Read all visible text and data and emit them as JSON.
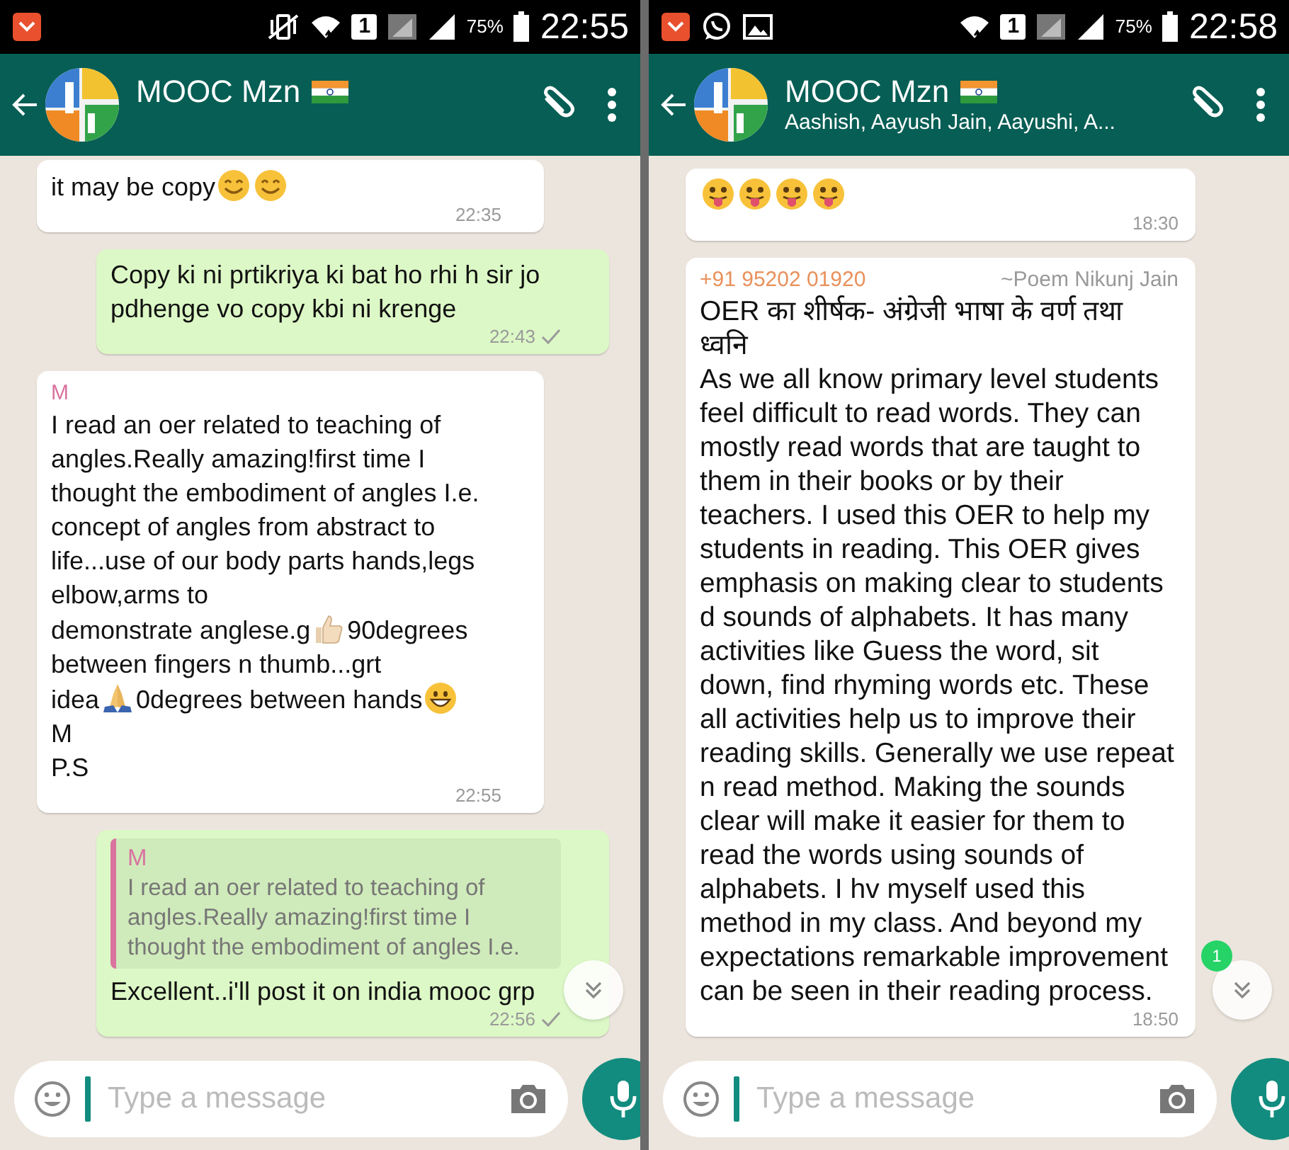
{
  "screens": [
    {
      "status_bar": {
        "notifications": [
          {
            "kind": "shop"
          }
        ],
        "vibrate_off": true,
        "sim": "1",
        "battery": "75%",
        "time": "22:55"
      },
      "header": {
        "title": "MOOC Mzn"
      },
      "messages": [
        {
          "outgoing": false,
          "paragraphs": [
            [
              {
                "kind": "text",
                "text": "it may be copy"
              },
              {
                "kind": "smiley"
              },
              {
                "kind": "smiley"
              }
            ]
          ],
          "time": "22:35"
        },
        {
          "outgoing": true,
          "paragraphs": [
            [
              {
                "kind": "text",
                "text": "Copy ki ni prtikriya ki bat ho rhi h sir jo pdhenge vo copy kbi ni krenge"
              }
            ]
          ],
          "time": "22:43",
          "sent": true
        },
        {
          "outgoing": false,
          "sender": {
            "name": "M",
            "color": "#d9739f"
          },
          "paragraphs": [
            [
              {
                "kind": "text",
                "text": "I read an oer related to teaching of angles.Really amazing!first time I thought the embodiment of angles I.e. concept of angles from abstract to life...use of our body parts hands,legs elbow,arms to"
              }
            ],
            [
              {
                "kind": "text",
                "text": "demonstrate anglese.g"
              },
              {
                "kind": "thumbsup"
              },
              {
                "kind": "text",
                "text": "90degrees"
              }
            ],
            [
              {
                "kind": "text",
                "text": "between fingers n thumb...grt"
              }
            ],
            [
              {
                "kind": "text",
                "text": "idea"
              },
              {
                "kind": "prayer"
              },
              {
                "kind": "text",
                "text": "0degrees between hands"
              },
              {
                "kind": "grin"
              }
            ],
            [
              {
                "kind": "text",
                "text": "M"
              }
            ],
            [
              {
                "kind": "text",
                "text": "P.S"
              }
            ]
          ],
          "time": "22:55"
        },
        {
          "outgoing": true,
          "quote": {
            "sender": "M",
            "color": "#d9739f",
            "text": "I read an oer related to teaching of angles.Really amazing!first time I thought the embodiment of angles I.e."
          },
          "paragraphs": [
            [
              {
                "kind": "text",
                "text": "Excellent..i'll post it on india mooc grp"
              }
            ]
          ],
          "time": "22:56",
          "sent": true
        }
      ],
      "scroll_button": {
        "shown": true
      },
      "composer": {
        "placeholder": "Type a message"
      }
    },
    {
      "status_bar": {
        "notifications": [
          {
            "kind": "shop"
          },
          {
            "kind": "chat"
          },
          {
            "kind": "gallery"
          }
        ],
        "vibrate_off": false,
        "sim": "1",
        "battery": "75%",
        "time": "22:58"
      },
      "header": {
        "title": "MOOC Mzn",
        "subtitle": "Aashish, Aayush Jain, Aayushi, A..."
      },
      "messages": [
        {
          "outgoing": false,
          "paragraphs": [
            [
              {
                "kind": "tongue"
              },
              {
                "kind": "tongue"
              },
              {
                "kind": "tongue"
              },
              {
                "kind": "tongue"
              }
            ]
          ],
          "time": "18:30"
        },
        {
          "outgoing": false,
          "sender": {
            "name": "+91 95202 01920",
            "color": "#e8915b"
          },
          "sender_note": "~Poem Nikunj Jain",
          "paragraphs": [
            [
              {
                "kind": "text",
                "text": "OER का शीर्षक- अंग्रेजी भाषा के वर्ण तथा ध्वनि"
              }
            ],
            [
              {
                "kind": "text",
                "text": "As we all know primary level students feel difficult to read words. They can mostly read words that are taught to them in their books or by their teachers. I used this OER to help my students in reading. This OER gives emphasis on making clear to students d sounds of alphabets. It has many activities like Guess the word, sit down, find rhyming words etc. These all activities help us to improve their reading skills. Generally we use repeat n read method. Making the sounds clear will make it easier for them to read the words using sounds of alphabets. I hv myself used this method in my class. And beyond my expectations remarkable improvement can be seen in their reading process."
              }
            ]
          ],
          "time": "18:50"
        }
      ],
      "scroll_button": {
        "shown": true,
        "badge": "1"
      },
      "composer": {
        "placeholder": "Type a message"
      }
    }
  ]
}
